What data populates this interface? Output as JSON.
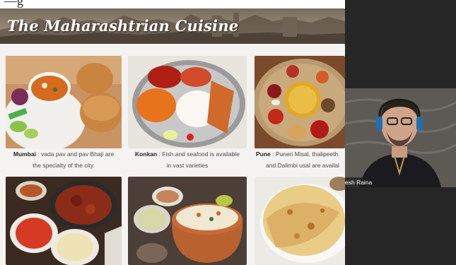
{
  "top_strip_text": "—g",
  "slide": {
    "title": "The Maharashtrian Cuisine",
    "captions": [
      {
        "city": "Mumbai",
        "line1": " : vada pav and pav Bhaji are",
        "line2": "the specialty of the city."
      },
      {
        "city": "Konkan",
        "line1": " : Fish and seafood is available",
        "line2": "in vast varieties"
      },
      {
        "city": "Pune",
        "line1": " : Puneri Misal, thalipeeth",
        "line2": "and Dalimbi usal are availal"
      }
    ]
  },
  "participant": {
    "name": "esh Raina"
  },
  "colors": {
    "side_panel": "#262626",
    "slide_bg": "#f4f3f1"
  }
}
